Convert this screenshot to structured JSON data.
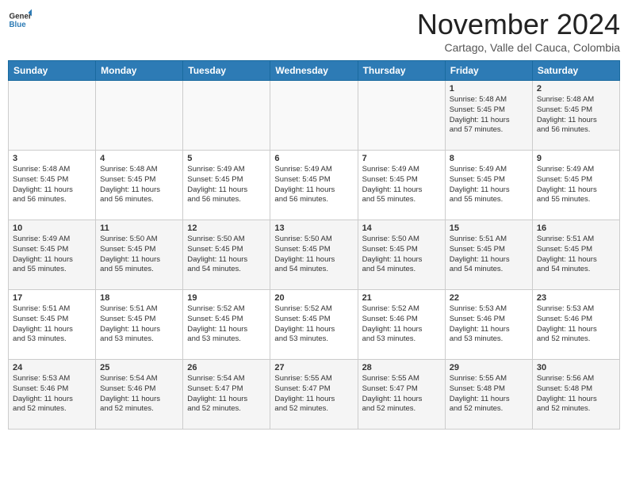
{
  "logo": {
    "line1": "General",
    "line2": "Blue"
  },
  "title": "November 2024",
  "subtitle": "Cartago, Valle del Cauca, Colombia",
  "weekdays": [
    "Sunday",
    "Monday",
    "Tuesday",
    "Wednesday",
    "Thursday",
    "Friday",
    "Saturday"
  ],
  "weeks": [
    [
      {
        "day": "",
        "info": ""
      },
      {
        "day": "",
        "info": ""
      },
      {
        "day": "",
        "info": ""
      },
      {
        "day": "",
        "info": ""
      },
      {
        "day": "",
        "info": ""
      },
      {
        "day": "1",
        "info": "Sunrise: 5:48 AM\nSunset: 5:45 PM\nDaylight: 11 hours\nand 57 minutes."
      },
      {
        "day": "2",
        "info": "Sunrise: 5:48 AM\nSunset: 5:45 PM\nDaylight: 11 hours\nand 56 minutes."
      }
    ],
    [
      {
        "day": "3",
        "info": "Sunrise: 5:48 AM\nSunset: 5:45 PM\nDaylight: 11 hours\nand 56 minutes."
      },
      {
        "day": "4",
        "info": "Sunrise: 5:48 AM\nSunset: 5:45 PM\nDaylight: 11 hours\nand 56 minutes."
      },
      {
        "day": "5",
        "info": "Sunrise: 5:49 AM\nSunset: 5:45 PM\nDaylight: 11 hours\nand 56 minutes."
      },
      {
        "day": "6",
        "info": "Sunrise: 5:49 AM\nSunset: 5:45 PM\nDaylight: 11 hours\nand 56 minutes."
      },
      {
        "day": "7",
        "info": "Sunrise: 5:49 AM\nSunset: 5:45 PM\nDaylight: 11 hours\nand 55 minutes."
      },
      {
        "day": "8",
        "info": "Sunrise: 5:49 AM\nSunset: 5:45 PM\nDaylight: 11 hours\nand 55 minutes."
      },
      {
        "day": "9",
        "info": "Sunrise: 5:49 AM\nSunset: 5:45 PM\nDaylight: 11 hours\nand 55 minutes."
      }
    ],
    [
      {
        "day": "10",
        "info": "Sunrise: 5:49 AM\nSunset: 5:45 PM\nDaylight: 11 hours\nand 55 minutes."
      },
      {
        "day": "11",
        "info": "Sunrise: 5:50 AM\nSunset: 5:45 PM\nDaylight: 11 hours\nand 55 minutes."
      },
      {
        "day": "12",
        "info": "Sunrise: 5:50 AM\nSunset: 5:45 PM\nDaylight: 11 hours\nand 54 minutes."
      },
      {
        "day": "13",
        "info": "Sunrise: 5:50 AM\nSunset: 5:45 PM\nDaylight: 11 hours\nand 54 minutes."
      },
      {
        "day": "14",
        "info": "Sunrise: 5:50 AM\nSunset: 5:45 PM\nDaylight: 11 hours\nand 54 minutes."
      },
      {
        "day": "15",
        "info": "Sunrise: 5:51 AM\nSunset: 5:45 PM\nDaylight: 11 hours\nand 54 minutes."
      },
      {
        "day": "16",
        "info": "Sunrise: 5:51 AM\nSunset: 5:45 PM\nDaylight: 11 hours\nand 54 minutes."
      }
    ],
    [
      {
        "day": "17",
        "info": "Sunrise: 5:51 AM\nSunset: 5:45 PM\nDaylight: 11 hours\nand 53 minutes."
      },
      {
        "day": "18",
        "info": "Sunrise: 5:51 AM\nSunset: 5:45 PM\nDaylight: 11 hours\nand 53 minutes."
      },
      {
        "day": "19",
        "info": "Sunrise: 5:52 AM\nSunset: 5:45 PM\nDaylight: 11 hours\nand 53 minutes."
      },
      {
        "day": "20",
        "info": "Sunrise: 5:52 AM\nSunset: 5:45 PM\nDaylight: 11 hours\nand 53 minutes."
      },
      {
        "day": "21",
        "info": "Sunrise: 5:52 AM\nSunset: 5:46 PM\nDaylight: 11 hours\nand 53 minutes."
      },
      {
        "day": "22",
        "info": "Sunrise: 5:53 AM\nSunset: 5:46 PM\nDaylight: 11 hours\nand 53 minutes."
      },
      {
        "day": "23",
        "info": "Sunrise: 5:53 AM\nSunset: 5:46 PM\nDaylight: 11 hours\nand 52 minutes."
      }
    ],
    [
      {
        "day": "24",
        "info": "Sunrise: 5:53 AM\nSunset: 5:46 PM\nDaylight: 11 hours\nand 52 minutes."
      },
      {
        "day": "25",
        "info": "Sunrise: 5:54 AM\nSunset: 5:46 PM\nDaylight: 11 hours\nand 52 minutes."
      },
      {
        "day": "26",
        "info": "Sunrise: 5:54 AM\nSunset: 5:47 PM\nDaylight: 11 hours\nand 52 minutes."
      },
      {
        "day": "27",
        "info": "Sunrise: 5:55 AM\nSunset: 5:47 PM\nDaylight: 11 hours\nand 52 minutes."
      },
      {
        "day": "28",
        "info": "Sunrise: 5:55 AM\nSunset: 5:47 PM\nDaylight: 11 hours\nand 52 minutes."
      },
      {
        "day": "29",
        "info": "Sunrise: 5:55 AM\nSunset: 5:48 PM\nDaylight: 11 hours\nand 52 minutes."
      },
      {
        "day": "30",
        "info": "Sunrise: 5:56 AM\nSunset: 5:48 PM\nDaylight: 11 hours\nand 52 minutes."
      }
    ]
  ]
}
